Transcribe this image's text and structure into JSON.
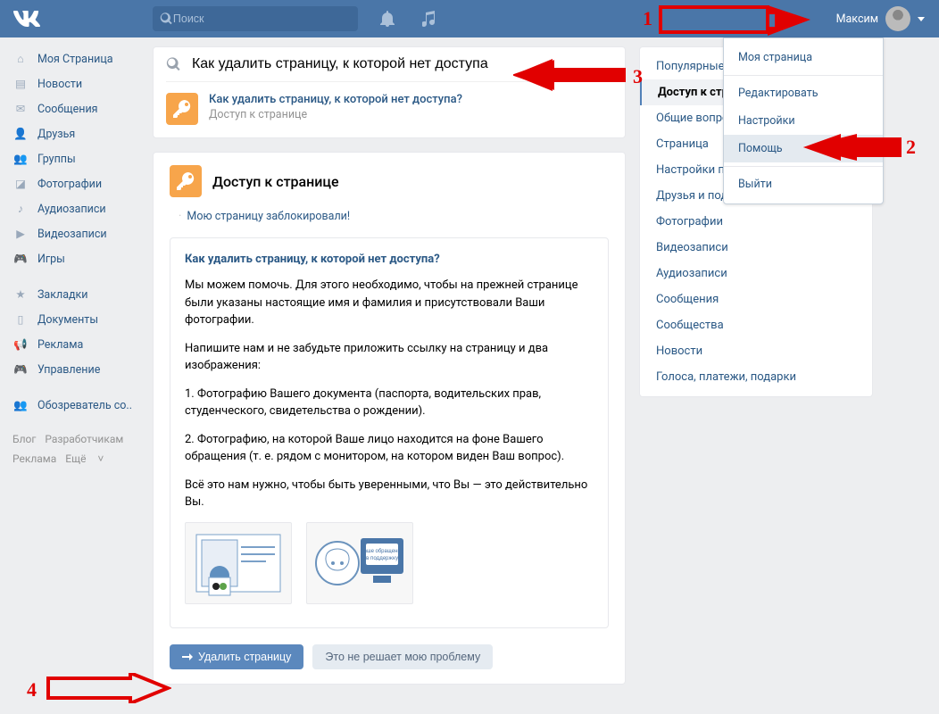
{
  "topbar": {
    "search_placeholder": "Поиск",
    "username": "Максим"
  },
  "leftnav": {
    "items": [
      {
        "label": "Моя Страница",
        "icon": "home"
      },
      {
        "label": "Новости",
        "icon": "news"
      },
      {
        "label": "Сообщения",
        "icon": "messages"
      },
      {
        "label": "Друзья",
        "icon": "friends"
      },
      {
        "label": "Группы",
        "icon": "groups"
      },
      {
        "label": "Фотографии",
        "icon": "photos"
      },
      {
        "label": "Аудиозаписи",
        "icon": "audio"
      },
      {
        "label": "Видеозаписи",
        "icon": "video"
      },
      {
        "label": "Игры",
        "icon": "games"
      }
    ],
    "items2": [
      {
        "label": "Закладки",
        "icon": "bookmark"
      },
      {
        "label": "Документы",
        "icon": "docs"
      },
      {
        "label": "Реклама",
        "icon": "ads"
      },
      {
        "label": "Управление",
        "icon": "manage"
      }
    ],
    "items3": [
      {
        "label": "Обозреватель со..",
        "icon": "observer"
      }
    ],
    "footer": {
      "blog": "Блог",
      "dev": "Разработчикам",
      "ads": "Реклама",
      "more": "Ещё"
    }
  },
  "search_card": {
    "query": "Как удалить страницу, к которой нет доступа",
    "result_title": "Как удалить страницу, к которой нет доступа?",
    "result_sub": "Доступ к странице"
  },
  "section": {
    "title": "Доступ к странице",
    "blocked_link": "Мою страницу заблокировали!"
  },
  "article": {
    "title": "Как удалить страницу, к которой нет доступа?",
    "p1": "Мы можем помочь. Для этого необходимо, чтобы на прежней странице были указаны настоящие имя и фамилия и присутствовали Ваши фотографии.",
    "p2": "Напишите нам и не забудьте приложить ссылку на страницу и два изображения:",
    "p3": "1. Фотографию Вашего документа (паспорта, водительских прав, студенческого, свидетельства о рождении).",
    "p4": "2. Фотографию, на которой Ваше лицо находится на фоне Вашего обращения (т. е. рядом с монитором, на котором виден Ваш вопрос).",
    "p5": "Всё это нам нужно, чтобы быть уверенными, что Вы — это действительно Вы."
  },
  "buttons": {
    "primary": "Удалить страницу",
    "secondary": "Это не решает мою проблему"
  },
  "rightcol": {
    "items": [
      "Популярные вопросы",
      "Доступ к странице",
      "Общие вопросы",
      "Страница",
      "Настройки приватности",
      "Друзья и подписчики",
      "Фотографии",
      "Видеозаписи",
      "Аудиозаписи",
      "Сообщения",
      "Сообщества",
      "Новости",
      "Голоса, платежи, подарки"
    ]
  },
  "dropdown": {
    "items": [
      "Моя страница",
      "Редактировать",
      "Настройки",
      "Помощь",
      "Выйти"
    ]
  },
  "annotations": {
    "n1": "1",
    "n2": "2",
    "n3": "3",
    "n4": "4"
  }
}
